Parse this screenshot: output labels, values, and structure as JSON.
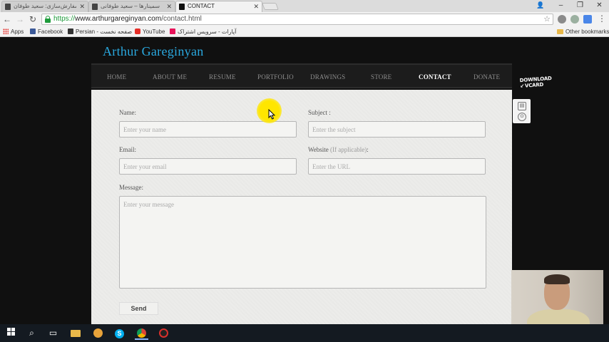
{
  "browser": {
    "tabs": [
      {
        "title": "سفارش‌سازی: سعید طوفان"
      },
      {
        "title": "سمینارها – سعید طوفانی"
      },
      {
        "title": "CONTACT"
      }
    ],
    "url": {
      "scheme": "https://",
      "host": "www.arthurgareginyan.com",
      "path": "/contact.html"
    },
    "bookmarks": [
      {
        "label": "Apps"
      },
      {
        "label": "Facebook"
      },
      {
        "label": "Persian - صفحه نخست"
      },
      {
        "label": "YouTube"
      },
      {
        "label": "آپارات - سرویس اشتراک"
      },
      {
        "label": "Other bookmarks"
      }
    ]
  },
  "site": {
    "title": "Arthur Gareginyan",
    "nav": [
      "HOME",
      "ABOUT ME",
      "RESUME",
      "PORTFOLIO",
      "DRAWINGS",
      "STORE",
      "CONTACT",
      "DONATE"
    ],
    "active_nav": "CONTACT"
  },
  "form": {
    "name": {
      "label": "Name:",
      "placeholder": "Enter your name"
    },
    "subject": {
      "label": "Subject :",
      "placeholder": "Enter the subject"
    },
    "email": {
      "label": "Email:",
      "placeholder": "Enter your email"
    },
    "website": {
      "label": "Website",
      "label_note": "(If applicable)",
      "label_suffix": ":",
      "placeholder": "Enter the URL"
    },
    "message": {
      "label": "Message:",
      "placeholder": "Enter your message"
    },
    "send_label": "Send"
  },
  "vcard": {
    "line1": "DOWNLOAD",
    "line2": "VCARD"
  },
  "colors": {
    "brand": "#2aa9e0",
    "page_bg": "#101010",
    "form_bg": "#ececea",
    "highlight": "#ffe600"
  }
}
